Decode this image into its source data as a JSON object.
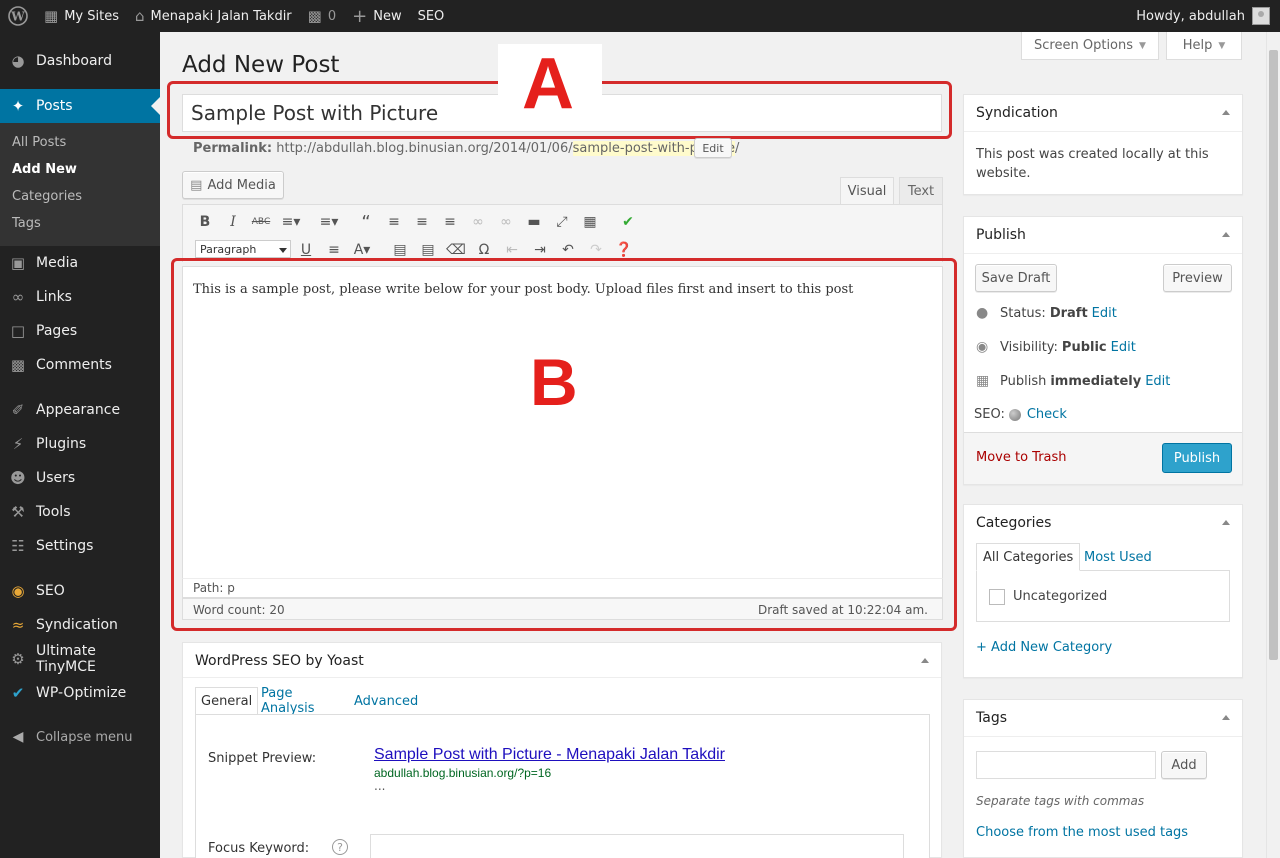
{
  "admin_bar": {
    "my_sites": "My Sites",
    "site_name": "Menapaki Jalan Takdir",
    "comments_count": "0",
    "new_label": "New",
    "seo_label": "SEO",
    "howdy": "Howdy, abdullah"
  },
  "sidebar": {
    "dashboard": "Dashboard",
    "posts": "Posts",
    "submenu": [
      "All Posts",
      "Add New",
      "Categories",
      "Tags"
    ],
    "media": "Media",
    "links": "Links",
    "pages": "Pages",
    "comments": "Comments",
    "appearance": "Appearance",
    "plugins": "Plugins",
    "users": "Users",
    "tools": "Tools",
    "settings": "Settings",
    "seo": "SEO",
    "syndication": "Syndication",
    "ultimate_tinymce": "Ultimate TinyMCE",
    "wp_optimize": "WP-Optimize",
    "collapse": "Collapse menu"
  },
  "screen_options": "Screen Options",
  "help": "Help",
  "page_title": "Add New Post",
  "post_title": "Sample Post with Picture",
  "permalink": {
    "label": "Permalink:",
    "base": "http://abdullah.blog.binusian.org/2014/01/06/",
    "slug": "sample-post-with-picture",
    "trail": "/",
    "edit": "Edit"
  },
  "add_media": "Add Media",
  "editor_tabs": {
    "visual": "Visual",
    "text": "Text"
  },
  "format_select": "Paragraph",
  "editor": {
    "content": "This is a sample post, please write below for your post body. Upload files first and insert to this post",
    "path": "Path: p",
    "word_count": "Word count: 20",
    "draft_saved": "Draft saved at 10:22:04 am."
  },
  "annotations": {
    "a": "A",
    "b": "B"
  },
  "syndication_box": {
    "title": "Syndication",
    "text": "This post was created locally at this website."
  },
  "publish_box": {
    "title": "Publish",
    "save_draft": "Save Draft",
    "preview": "Preview",
    "status_label": "Status:",
    "status_value": "Draft",
    "visibility_label": "Visibility:",
    "visibility_value": "Public",
    "publish_label": "Publish",
    "publish_value": "immediately",
    "edit": "Edit",
    "seo_label": "SEO:",
    "check": "Check",
    "move_to_trash": "Move to Trash",
    "publish_button": "Publish"
  },
  "categories_box": {
    "title": "Categories",
    "tab_all": "All Categories",
    "tab_most_used": "Most Used",
    "item": "Uncategorized",
    "add_new": "+ Add New Category"
  },
  "tags_box": {
    "title": "Tags",
    "add": "Add",
    "hint": "Separate tags with commas",
    "choose": "Choose from the most used tags"
  },
  "seo_box": {
    "title": "WordPress SEO by Yoast",
    "tabs": [
      "General",
      "Page Analysis",
      "Advanced"
    ],
    "snippet_label": "Snippet Preview:",
    "snippet_title": "Sample Post with Picture - Menapaki Jalan Takdir",
    "snippet_url": "abdullah.blog.binusian.org/?p=16",
    "snippet_desc": "...",
    "focus_label": "Focus Keyword:",
    "help": "?"
  },
  "colors": {
    "admin_dark": "#222222",
    "accent": "#0074a2",
    "publish_button": "#2ea2cc",
    "annotation_red": "#e5201c"
  }
}
